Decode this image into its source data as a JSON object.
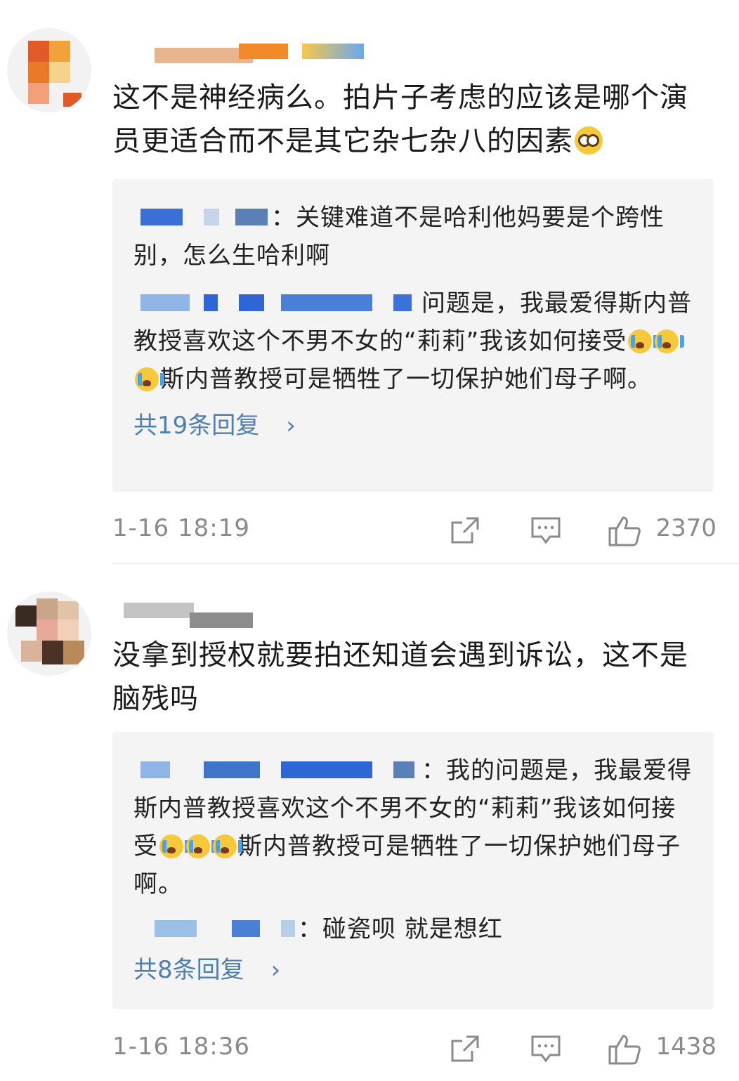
{
  "comments": [
    {
      "text": "这不是神经病么。拍片子考虑的应该是哪个演员更适合而不是其它杂七杂八的因素",
      "emoji": "flushed-face-emoji",
      "replies": [
        {
          "text": "：关键难道不是哈利他妈要是个跨性别，怎么生哈利啊"
        },
        {
          "text": "问题是，我最爱得斯内普教授喜欢这个不男不女的“莉莉”我该如何接受",
          "emoji": "crying-face-emoji",
          "text2": "斯内普教授可是牺牲了一切保护她们母子啊。"
        }
      ],
      "more_replies": "共19条回复",
      "chevron": "›",
      "time": "1-16  18:19",
      "likes": "2370"
    },
    {
      "text": "没拿到授权就要拍还知道会遇到诉讼，这不是脑残吗",
      "replies": [
        {
          "text": "：我的问题是，我最爱得斯内普教授喜欢这个不男不女的“莉莉”我该如何接受",
          "emoji": "crying-face-emoji",
          "text2": "斯内普教授可是牺牲了一切保护她们母子啊。"
        },
        {
          "text": "：碰瓷呗    就是想红"
        }
      ],
      "more_replies": "共8条回复",
      "chevron": "›",
      "time": "1-16  18:36",
      "likes": "1438"
    }
  ],
  "colors": {
    "link": "#4f7fae",
    "meta": "#8a8a8a",
    "reply_bg": "#f4f4f4"
  },
  "icons": [
    "share-icon",
    "comment-icon",
    "like-icon"
  ]
}
